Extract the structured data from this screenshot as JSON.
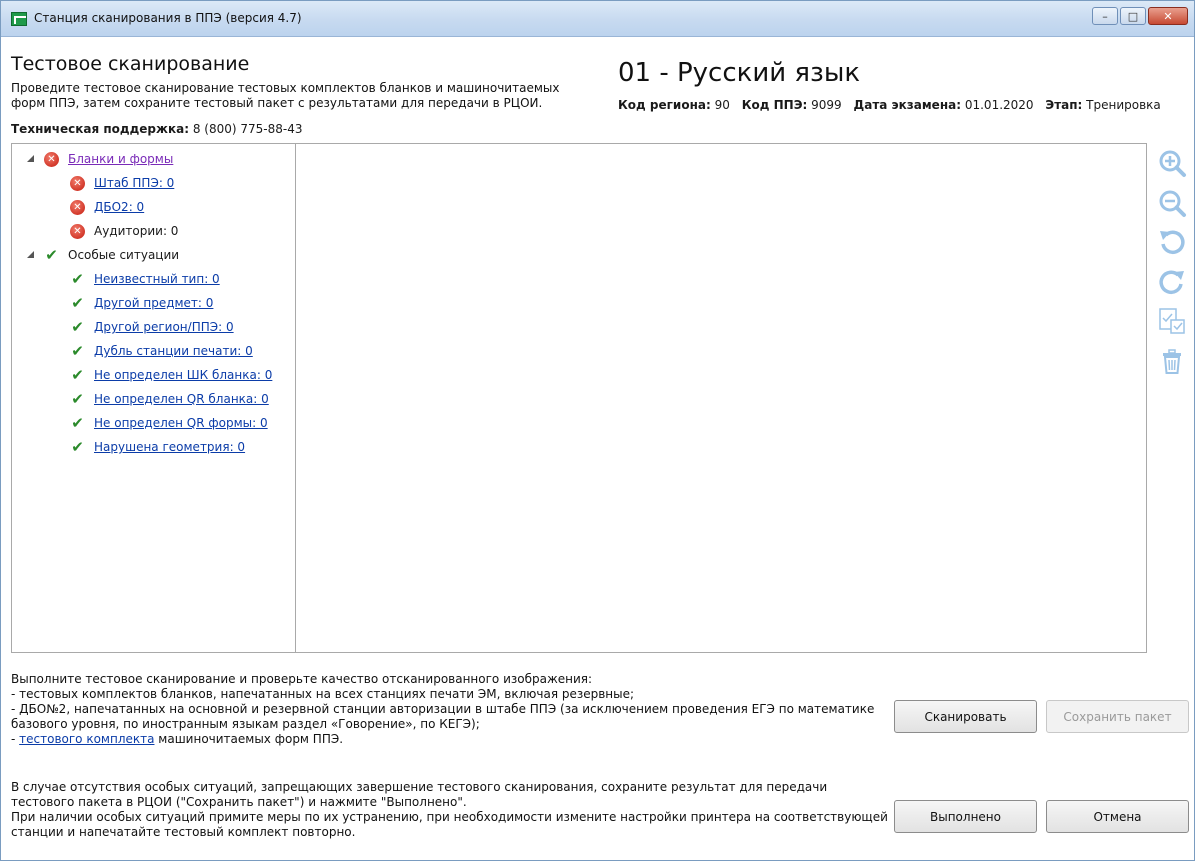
{
  "window": {
    "title": "Станция сканирования в ППЭ (версия 4.7)",
    "buttons": {
      "minimize": "–",
      "maximize": "□",
      "close": "✕"
    }
  },
  "header": {
    "title": "Тестовое сканирование",
    "description": "Проведите тестовое сканирование тестовых комплектов бланков и машиночитаемых форм ППЭ, затем сохраните тестовый пакет с результатами для передачи в РЦОИ.",
    "support_label": "Техническая поддержка:",
    "support_phone": "8 (800) 775-88-43",
    "subject": "01 - Русский язык",
    "region_label": "Код региона:",
    "region_value": "90",
    "ppe_label": "Код ППЭ:",
    "ppe_value": "9099",
    "date_label": "Дата экзамена:",
    "date_value": "01.01.2020",
    "stage_label": "Этап:",
    "stage_value": "Тренировка"
  },
  "tree": {
    "blanks": {
      "label": "Бланки и формы",
      "items": [
        "Штаб ППЭ: 0",
        "ДБО2: 0",
        "Аудитории: 0"
      ]
    },
    "special": {
      "label": "Особые ситуации",
      "items": [
        "Неизвестный тип: 0",
        "Другой предмет: 0",
        "Другой регион/ППЭ: 0",
        "Дубль станции печати: 0",
        "Не определен ШК бланка: 0",
        "Не определен QR бланка: 0",
        "Не определен QR формы: 0",
        "Нарушена геометрия: 0"
      ]
    }
  },
  "toolbar": {
    "icons": [
      "zoom-in-icon",
      "zoom-out-icon",
      "rotate-left-icon",
      "rotate-right-icon",
      "check-pages-icon",
      "delete-icon"
    ]
  },
  "instructions": {
    "line1": "Выполните тестовое сканирование и проверьте качество отсканированного изображения:",
    "line2": "- тестовых комплектов бланков, напечатанных на всех станциях печати ЭМ, включая резервные;",
    "line3": "- ДБО№2, напечатанных на основной и резервной станции авторизации в штабе ППЭ (за исключением проведения ЕГЭ по математике базового уровня, по иностранным языкам раздел «Говорение», по КЕГЭ);",
    "line4_prefix": "- ",
    "line4_link": "тестового комплекта",
    "line4_suffix": " машиночитаемых форм ППЭ."
  },
  "note": {
    "text1": "В случае отсутствия особых ситуаций, запрещающих завершение тестового сканирования, сохраните результат для передачи тестового пакета в РЦОИ (\"Сохранить пакет\") и нажмите \"Выполнено\".",
    "text2": "При наличии особых ситуаций примите меры по их устранению, при необходимости измените настройки принтера на соответствующей станции и напечатайте тестовый комплект повторно."
  },
  "buttons": {
    "scan": "Сканировать",
    "save_package": "Сохранить пакет",
    "done": "Выполнено",
    "cancel": "Отмена"
  },
  "colors": {
    "link": "#0b3ca8",
    "visited_link": "#7a2bb8",
    "error": "#d2382a",
    "ok": "#2b8a2b",
    "toolbar_icon": "#9cc3e6"
  }
}
